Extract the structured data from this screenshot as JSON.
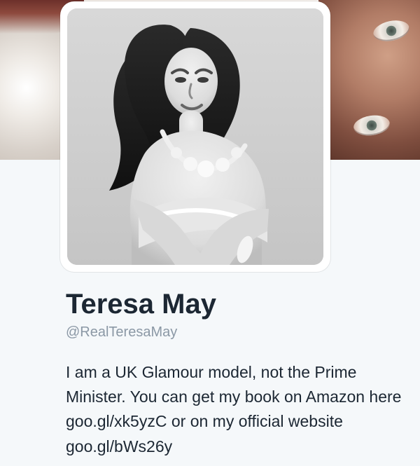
{
  "profile": {
    "display_name": "Teresa May",
    "handle": "@RealTeresaMay",
    "bio": {
      "part1": "I am a UK Glamour model, not the Prime Minister. You can get my book on Amazon here ",
      "link1": "goo.gl/xk5yzC",
      "part2": " or on my official website ",
      "link2": "goo.gl/bWs26y"
    }
  },
  "colors": {
    "page_background": "#f5f8fa",
    "text": "#1c2733",
    "muted_text": "#8b98a5",
    "avatar_border": "#ffffff"
  },
  "icons": {
    "avatar": "profile-photo"
  }
}
